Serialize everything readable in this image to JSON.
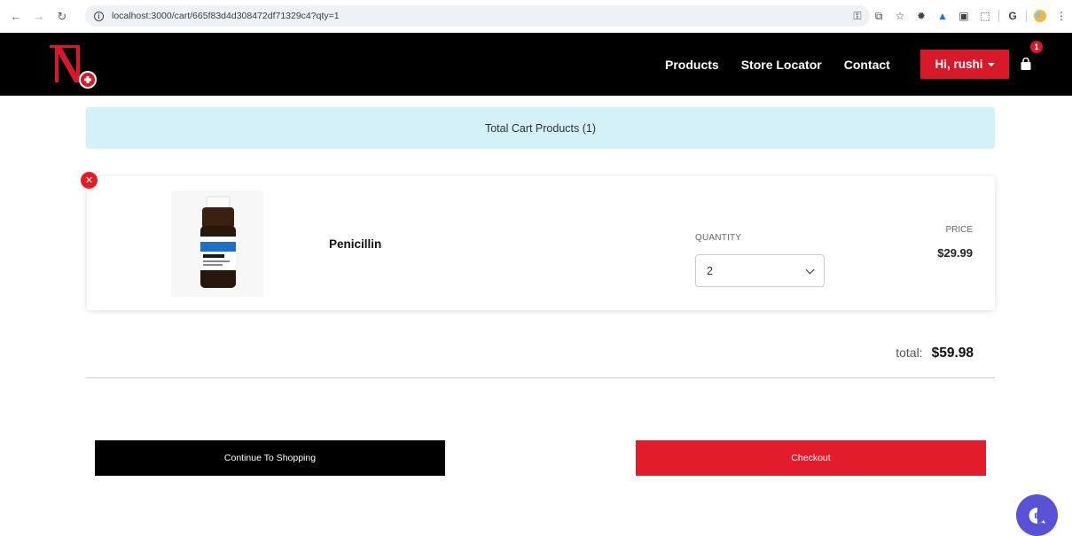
{
  "browser": {
    "url": "localhost:3000/cart/665f83d4d308472df71329c4?qty=1",
    "back_icon": "back-arrow-icon",
    "forward_icon": "forward-arrow-icon",
    "reload_icon": "reload-icon"
  },
  "header": {
    "nav": [
      "Products",
      "Store Locator",
      "Contact"
    ],
    "user_label": "Hi, rushi",
    "cart_count": "1",
    "colors": {
      "bar": "#000000",
      "accent": "#d8192a"
    }
  },
  "cart": {
    "summary": "Total Cart Products (1)",
    "items": [
      {
        "name": "Penicillin",
        "quantity_label": "QUANTITY",
        "quantity": "2",
        "price_label": "PRICE",
        "price": "$29.99"
      }
    ],
    "total_label": "total:",
    "total_value": "$59.98",
    "continue_label": "Continue To Shopping",
    "checkout_label": "Checkout"
  }
}
